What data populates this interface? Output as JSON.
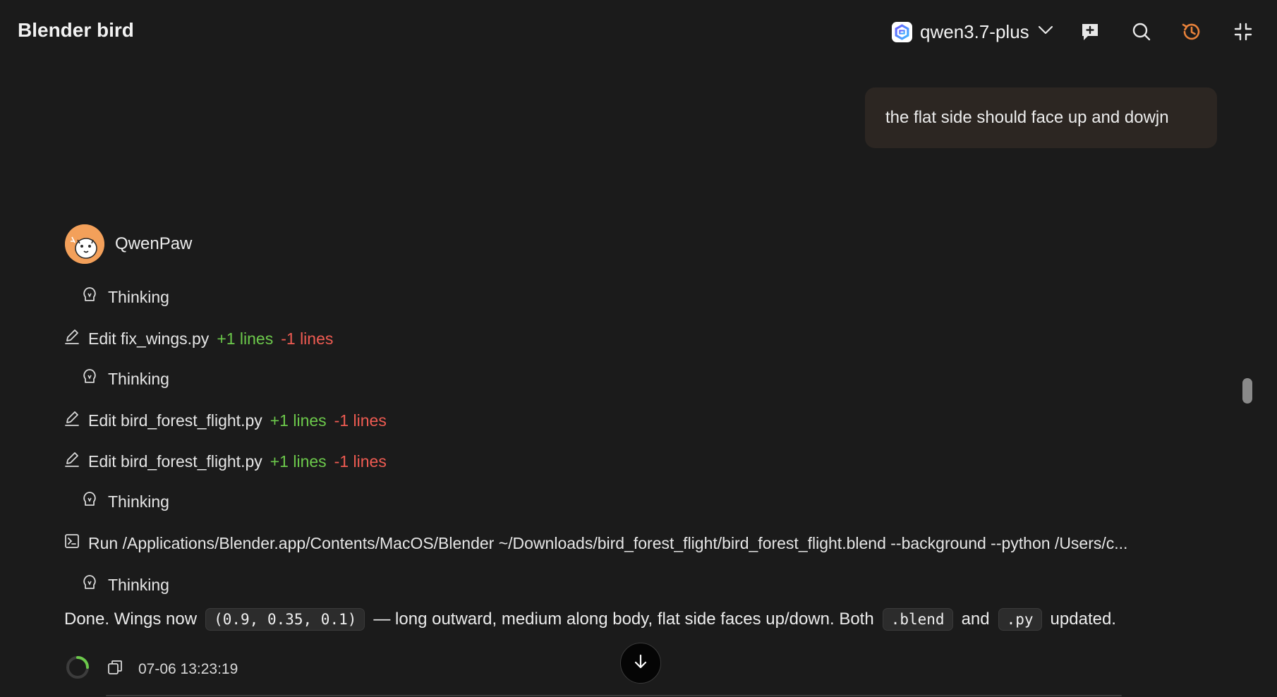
{
  "header": {
    "title": "Blender bird",
    "model": "qwen3.7-plus",
    "icons": [
      "chevron-down-icon",
      "new-chat-icon",
      "search-icon",
      "history-icon",
      "collapse-icon"
    ]
  },
  "user_message": "the flat side should face up and dowjn",
  "agent": {
    "name": "QwenPaw",
    "steps": [
      {
        "type": "thinking",
        "label": "Thinking"
      },
      {
        "type": "edit",
        "label": "Edit fix_wings.py",
        "added": "+1 lines",
        "removed": "-1 lines"
      },
      {
        "type": "thinking",
        "label": "Thinking"
      },
      {
        "type": "edit",
        "label": "Edit bird_forest_flight.py",
        "added": "+1 lines",
        "removed": "-1 lines"
      },
      {
        "type": "edit",
        "label": "Edit bird_forest_flight.py",
        "added": "+1 lines",
        "removed": "-1 lines"
      },
      {
        "type": "thinking",
        "label": "Thinking"
      },
      {
        "type": "run",
        "label": "Run /Applications/Blender.app/Contents/MacOS/Blender ~/Downloads/bird_forest_flight/bird_forest_flight.blend --background --python /Users/c..."
      },
      {
        "type": "thinking",
        "label": "Thinking"
      }
    ],
    "final": {
      "part1": "Done. Wings now",
      "code1": "(0.9, 0.35, 0.1)",
      "part2": "— long outward, medium along body, flat side faces up/down. Both",
      "code2": ".blend",
      "part3": "and",
      "code3": ".py",
      "part4": "updated."
    },
    "timestamp": "07-06 13:23:19"
  },
  "colors": {
    "background": "#1b1b1b",
    "added": "#6cc94b",
    "removed": "#ef5b52",
    "history_accent": "#e8823a",
    "user_bubble": "#2c2622"
  }
}
